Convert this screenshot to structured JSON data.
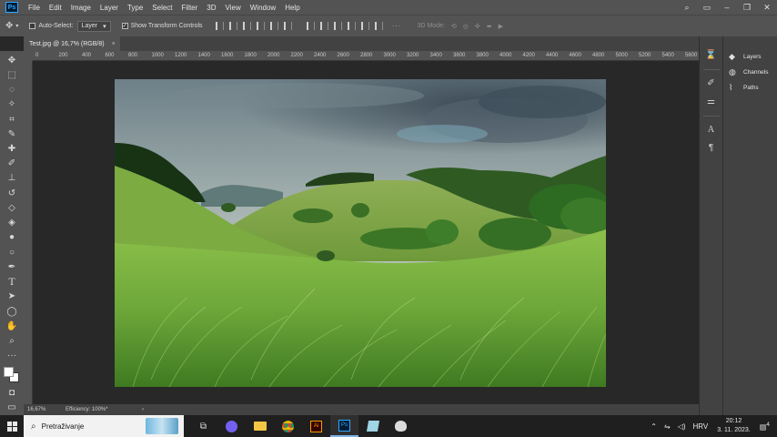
{
  "menubar": {
    "logo": "Ps",
    "items": [
      "File",
      "Edit",
      "Image",
      "Layer",
      "Type",
      "Select",
      "Filter",
      "3D",
      "View",
      "Window",
      "Help"
    ]
  },
  "options": {
    "auto_select_label": "Auto-Select:",
    "auto_select_value": "Layer",
    "show_transform_label": "Show Transform Controls",
    "mode3d_label": "3D Mode:"
  },
  "document": {
    "tab_label": "Test.jpg @ 16,7% (RGB/8)",
    "close": "×"
  },
  "ruler": {
    "top_ticks": [
      "0",
      "200",
      "400",
      "600",
      "800",
      "1000",
      "1200",
      "1400",
      "1600",
      "1800",
      "2000",
      "2200",
      "2400",
      "2600",
      "2800",
      "3000",
      "3200",
      "3400",
      "3600",
      "3800",
      "4000",
      "4200",
      "4400",
      "4600",
      "4800",
      "5000",
      "5200",
      "5400",
      "5600",
      "58"
    ]
  },
  "status": {
    "zoom": "16,67%",
    "efficiency": "Efficiency: 100%*",
    "arrow": "›"
  },
  "panels": {
    "layers": "Layers",
    "channels": "Channels",
    "paths": "Paths"
  },
  "taskbar": {
    "search_placeholder": "Pretraživanje",
    "language": "HRV",
    "time": "20:12",
    "date": "3. 11. 2023.",
    "notifications": "4"
  },
  "colors": {
    "ui_bg": "#535353",
    "dark_bg": "#282828",
    "panel_bg": "#424242",
    "ps_blue": "#31a8ff"
  }
}
